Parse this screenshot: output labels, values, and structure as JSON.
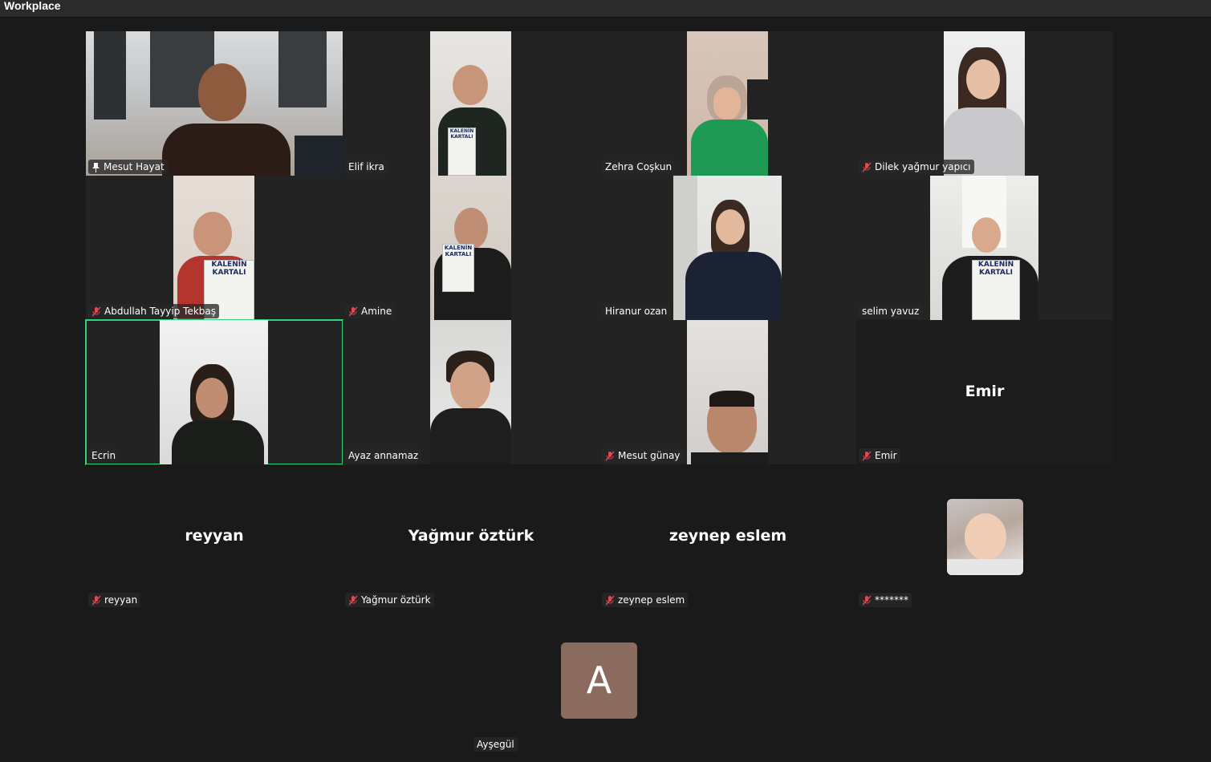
{
  "window": {
    "title": "Workplace"
  },
  "participants": [
    {
      "name": "Mesut Hayat",
      "icon": "pin-icon"
    },
    {
      "name": "Elif ikra",
      "icon": ""
    },
    {
      "name": "Zehra Coşkun",
      "icon": ""
    },
    {
      "name": "Dilek yağmur yapıcı",
      "icon": "mic-muted-icon"
    },
    {
      "name": "Abdullah Tayyip Tekbaş",
      "icon": "mic-muted-icon"
    },
    {
      "name": "Amine",
      "icon": "mic-muted-icon"
    },
    {
      "name": "Hiranur ozan",
      "icon": ""
    },
    {
      "name": "selim yavuz",
      "icon": ""
    },
    {
      "name": "Ecrin",
      "icon": "",
      "active_speaker": true
    },
    {
      "name": "Ayaz annamaz",
      "icon": ""
    },
    {
      "name": "Mesut günay",
      "icon": "mic-muted-icon"
    },
    {
      "name": "Emir",
      "icon": "mic-muted-icon",
      "display_name": "Emir"
    },
    {
      "name": "reyyan",
      "icon": "mic-muted-icon",
      "display_name": "reyyan"
    },
    {
      "name": "Yağmur öztürk",
      "icon": "mic-muted-icon",
      "display_name": "Yağmur öztürk"
    },
    {
      "name": "zeynep eslem",
      "icon": "mic-muted-icon",
      "display_name": "zeynep eslem"
    },
    {
      "name": "*******",
      "icon": "mic-muted-icon"
    },
    {
      "name": "Ayşegül",
      "icon": "",
      "avatar_letter": "A"
    }
  ],
  "book_title": "KALENİN KARTALI",
  "colors": {
    "background": "#1a1a1a",
    "tile": "#232323",
    "active_border": "#2fd37a",
    "muted_mic": "#e5484d",
    "avatar_letter_bg": "#8b6b5e"
  }
}
